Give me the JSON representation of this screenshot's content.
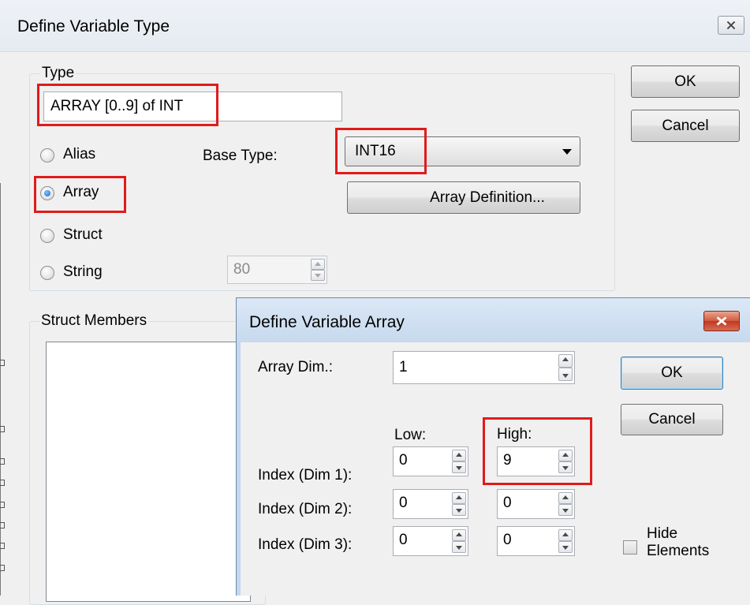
{
  "outer_dialog": {
    "title": "Define Variable Type",
    "close_icon": "close-icon",
    "ok_label": "OK",
    "cancel_label": "Cancel",
    "type_group": {
      "legend": "Type",
      "type_value": "ARRAY [0..9] of INT",
      "radios": [
        {
          "label": "Alias",
          "selected": false
        },
        {
          "label": "Array",
          "selected": true
        },
        {
          "label": "Struct",
          "selected": false
        },
        {
          "label": "String",
          "selected": false
        }
      ],
      "base_type_label": "Base Type:",
      "base_type_value": "INT16",
      "array_definition_label": "Array Definition...",
      "string_length_value": "80"
    },
    "struct_members": {
      "legend": "Struct Members"
    }
  },
  "inner_dialog": {
    "title": "Define Variable Array",
    "close_icon": "close-icon",
    "array_dim_label": "Array Dim.:",
    "array_dim_value": "1",
    "ok_label": "OK",
    "cancel_label": "Cancel",
    "low_header": "Low:",
    "high_header": "High:",
    "rows": [
      {
        "label": "Index (Dim 1):",
        "low": "0",
        "high": "9"
      },
      {
        "label": "Index (Dim 2):",
        "low": "0",
        "high": "0"
      },
      {
        "label": "Index (Dim 3):",
        "low": "0",
        "high": "0"
      }
    ],
    "hide_elements_line1": "Hide",
    "hide_elements_line2": "Elements",
    "hide_elements_checked": false
  },
  "colors": {
    "highlight": "#e01b1b",
    "background": "#f0f0f0",
    "inner_titlebar": "#c7d9ee"
  }
}
